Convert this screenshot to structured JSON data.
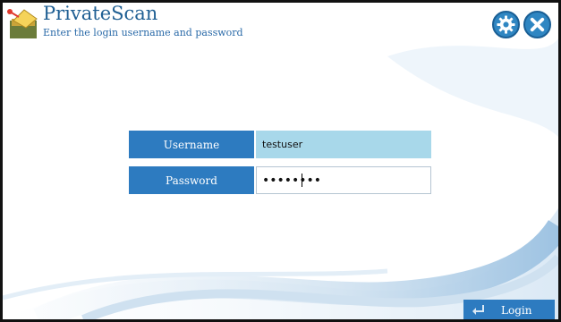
{
  "app": {
    "title": "PrivateScan",
    "subtitle": "Enter the login username and password"
  },
  "header": {
    "icons": [
      "app-logo-icon",
      "gear-icon",
      "close-icon"
    ]
  },
  "form": {
    "username_label": "Username",
    "username_value": "testuser",
    "password_label": "Password",
    "password_value": "••••••••"
  },
  "actions": {
    "login_label": "Login",
    "login_icon": "enter-arrow-icon"
  },
  "colors": {
    "accent": "#2d7bc0",
    "title_text": "#1f5f93",
    "username_field_bg": "#a8d8ea"
  }
}
